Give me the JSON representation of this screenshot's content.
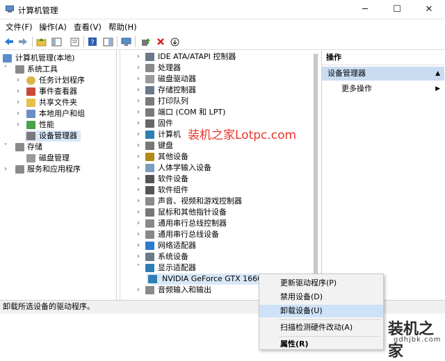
{
  "window": {
    "title": "计算机管理"
  },
  "menu": [
    "文件(F)",
    "操作(A)",
    "查看(V)",
    "帮助(H)"
  ],
  "left_tree": {
    "root": "计算机管理(本地)",
    "system_tools": "系统工具",
    "system_children": [
      "任务计划程序",
      "事件查看器",
      "共享文件夹",
      "本地用户和组",
      "性能",
      "设备管理器"
    ],
    "storage": "存储",
    "storage_children": [
      "磁盘管理"
    ],
    "services": "服务和应用程序"
  },
  "devices": [
    "IDE ATA/ATAPI 控制器",
    "处理器",
    "磁盘驱动器",
    "存储控制器",
    "打印队列",
    "端口 (COM 和 LPT)",
    "固件",
    "计算机",
    "键盘",
    "其他设备",
    "人体学输入设备",
    "软件设备",
    "软件组件",
    "声音、视频和游戏控制器",
    "鼠标和其他指针设备",
    "通用串行总线控制器",
    "通用串行总线设备",
    "网络适配器",
    "系统设备",
    "显示适配器"
  ],
  "gpu_item": "NVIDIA GeForce GTX 1660",
  "audio_item": "音频输入和输出",
  "actions": {
    "header": "操作",
    "section": "设备管理器",
    "more": "更多操作"
  },
  "context_menu": [
    "更新驱动程序(P)",
    "禁用设备(D)",
    "卸载设备(U)",
    "扫描检测硬件改动(A)",
    "属性(R)"
  ],
  "status": "卸载所选设备的驱动程序。",
  "watermark": "装机之家Lotpc.com",
  "brand": {
    "name": "装机之家",
    "url": "gdhjbk.com"
  },
  "colors": {
    "selection": "#d9e8f7",
    "action_band": "#c9dcf1",
    "watermark": "#e8352a"
  }
}
